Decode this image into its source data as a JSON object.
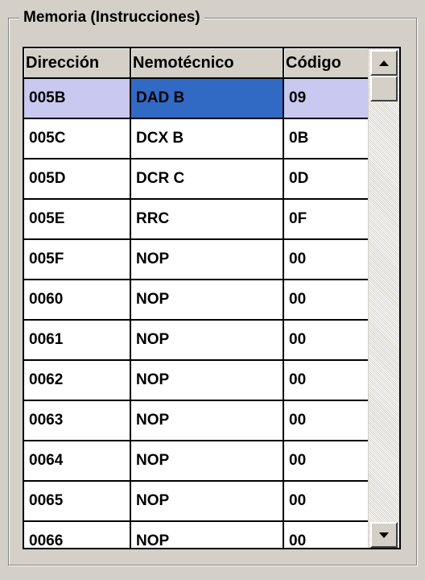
{
  "group": {
    "title": "Memoria (Instrucciones)"
  },
  "table": {
    "columns": [
      "Dirección",
      "Nemotécnico",
      "Código"
    ],
    "rows": [
      {
        "address": "005B",
        "mnemonic": "DAD B",
        "code": "09",
        "selected": true
      },
      {
        "address": "005C",
        "mnemonic": "DCX B",
        "code": "0B"
      },
      {
        "address": "005D",
        "mnemonic": "DCR C",
        "code": "0D"
      },
      {
        "address": "005E",
        "mnemonic": "RRC",
        "code": "0F"
      },
      {
        "address": "005F",
        "mnemonic": "NOP",
        "code": "00"
      },
      {
        "address": "0060",
        "mnemonic": "NOP",
        "code": "00"
      },
      {
        "address": "0061",
        "mnemonic": "NOP",
        "code": "00"
      },
      {
        "address": "0062",
        "mnemonic": "NOP",
        "code": "00"
      },
      {
        "address": "0063",
        "mnemonic": "NOP",
        "code": "00"
      },
      {
        "address": "0064",
        "mnemonic": "NOP",
        "code": "00"
      },
      {
        "address": "0065",
        "mnemonic": "NOP",
        "code": "00"
      },
      {
        "address": "0066",
        "mnemonic": "NOP",
        "code": "00"
      }
    ]
  },
  "scrollbar": {
    "up_icon": "arrow-up-icon",
    "down_icon": "arrow-down-icon"
  },
  "colors": {
    "selected_row": "#c8c8f0",
    "selected_cell": "#316ac5",
    "face": "#d4d0c8"
  }
}
